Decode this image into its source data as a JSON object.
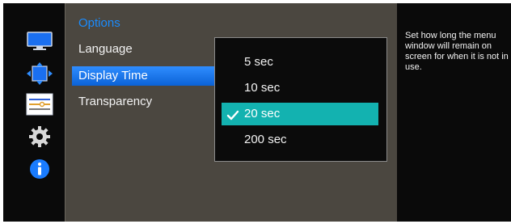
{
  "menu": {
    "title": "Options",
    "items": [
      {
        "label": "Language",
        "selected": false
      },
      {
        "label": "Display Time",
        "selected": true
      },
      {
        "label": "Transparency",
        "selected": false
      }
    ]
  },
  "submenu": {
    "options": [
      {
        "label": "5 sec",
        "checked": false
      },
      {
        "label": "10 sec",
        "checked": false
      },
      {
        "label": "20 sec",
        "checked": true
      },
      {
        "label": "200 sec",
        "checked": false
      }
    ]
  },
  "help": {
    "text": "Set how long the menu window will remain on screen for when it is not in use."
  },
  "icons": [
    "monitor-icon",
    "move-arrows-icon",
    "settings-sliders-icon",
    "gear-icon",
    "info-icon"
  ],
  "colors": {
    "accent_blue": "#2f8dff",
    "title_blue": "#1a8cff",
    "selection_teal": "#13b2b0",
    "panel_bg": "#4b4740"
  }
}
